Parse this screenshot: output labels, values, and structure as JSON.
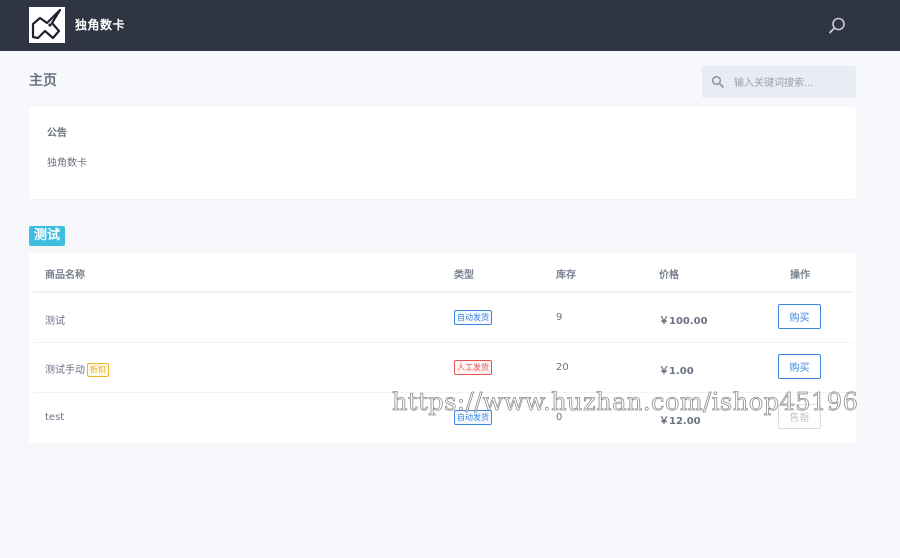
{
  "header": {
    "brand": "独角数卡",
    "logo_icon": "unicorn-icon",
    "search_icon": "search-icon"
  },
  "page": {
    "title": "主页"
  },
  "search": {
    "placeholder": "输入关键词搜索..."
  },
  "notice": {
    "title": "公告",
    "body": "独角数卡"
  },
  "category": {
    "label": "测试"
  },
  "table": {
    "headers": [
      "商品名称",
      "类型",
      "库存",
      "价格",
      "操作"
    ],
    "rows": [
      {
        "name": "测试",
        "badge": "",
        "type": "自动发货",
        "type_kind": "auto",
        "stock": "9",
        "price": "￥100.00",
        "action": "购买"
      },
      {
        "name": "测试手动",
        "badge": "折扣",
        "type": "人工发货",
        "type_kind": "manual",
        "stock": "20",
        "price": "￥1.00",
        "action": "购买"
      },
      {
        "name": "test",
        "badge": "",
        "type": "自动发货",
        "type_kind": "auto",
        "stock": "0",
        "price": "￥12.00",
        "action": "售罄"
      }
    ]
  },
  "watermark": "https://www.huzhan.com/ishop45196",
  "colors": {
    "topbar": "#2f3542",
    "accent": "#3c86e0",
    "category": "#3ebde0",
    "manual": "#e55353",
    "discount": "#f0b429"
  }
}
